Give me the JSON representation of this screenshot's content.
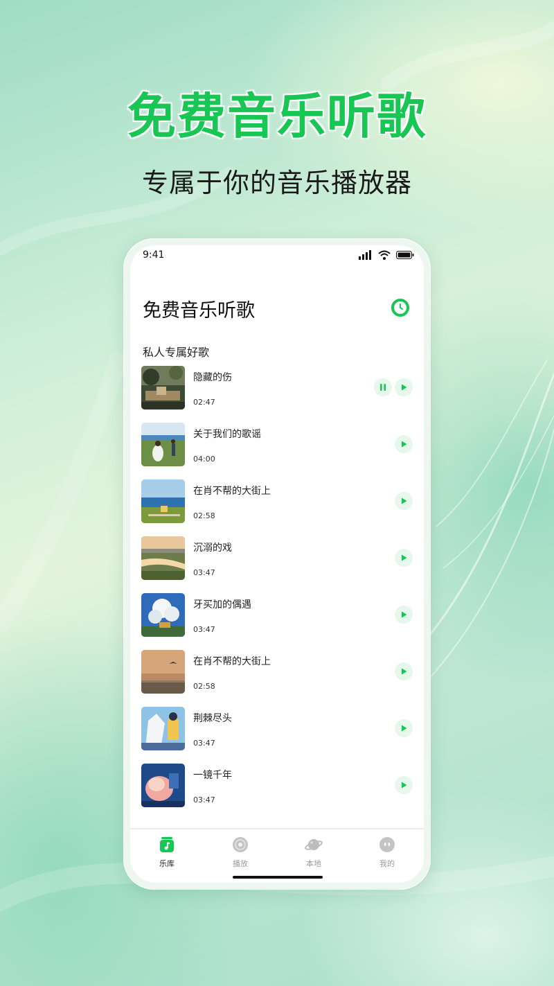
{
  "promo": {
    "headline": "免费音乐听歌",
    "subline": "专属于你的音乐播放器"
  },
  "status_bar": {
    "time": "9:41",
    "icons": [
      "signal-icon",
      "wifi-icon",
      "battery-icon"
    ]
  },
  "header": {
    "title": "免费音乐听歌",
    "history_icon": "clock-icon"
  },
  "section": {
    "title": "私人专属好歌"
  },
  "songs": [
    {
      "title": "隐藏的伤",
      "duration": "02:47",
      "playing": true
    },
    {
      "title": "关于我们的歌谣",
      "duration": "04:00"
    },
    {
      "title": "在肖不帮的大街上",
      "duration": "02:58"
    },
    {
      "title": "沉溺的戏",
      "duration": "03:47"
    },
    {
      "title": "牙买加的偶遇",
      "duration": "03:47"
    },
    {
      "title": "在肖不帮的大街上",
      "duration": "02:58"
    },
    {
      "title": "荆棘尽头",
      "duration": "03:47"
    },
    {
      "title": "一镜千年",
      "duration": "03:47"
    }
  ],
  "tabbar": {
    "tabs": [
      {
        "label": "乐库",
        "icon": "music-library-icon",
        "active": true
      },
      {
        "label": "播放",
        "icon": "disc-icon",
        "active": false
      },
      {
        "label": "本地",
        "icon": "planet-icon",
        "active": false
      },
      {
        "label": "我的",
        "icon": "profile-icon",
        "active": false
      }
    ]
  },
  "colors": {
    "accent": "#17c653",
    "accent_soft": "#e6f8ec",
    "text": "#111111",
    "inactive": "#9a9a9a"
  }
}
